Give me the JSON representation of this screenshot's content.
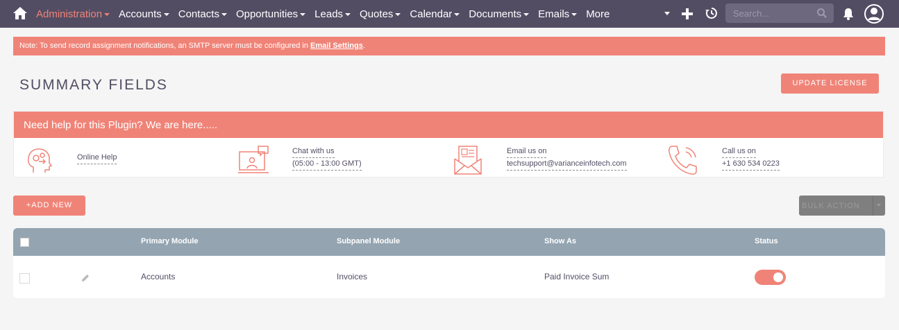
{
  "colors": {
    "accent": "#f08377",
    "navbar": "#534d64",
    "table_header": "#94a4b1"
  },
  "navbar": {
    "items": [
      {
        "label": "Administration",
        "active": true
      },
      {
        "label": "Accounts"
      },
      {
        "label": "Contacts"
      },
      {
        "label": "Opportunities"
      },
      {
        "label": "Leads"
      },
      {
        "label": "Quotes"
      },
      {
        "label": "Calendar"
      },
      {
        "label": "Documents"
      },
      {
        "label": "Emails"
      },
      {
        "label": "More"
      }
    ],
    "search_placeholder": "Search..."
  },
  "note": {
    "text": "Note: To send record assignment notifications, an SMTP server must be configured in ",
    "link": "Email Settings",
    "suffix": "."
  },
  "page": {
    "title": "SUMMARY FIELDS",
    "update_license": "UPDATE LICENSE",
    "add_new": "+ADD NEW",
    "bulk_action": "BULK ACTION"
  },
  "help": {
    "header": "Need help for this Plugin? We are here.....",
    "online_help": "Online Help",
    "chat_line1": "Chat with us",
    "chat_line2": "(05:00 - 13:00 GMT)",
    "email_line1": "Email us on",
    "email_line2": "techsupport@varianceinfotech.com",
    "call_line1": "Call us on",
    "call_line2": "+1 630 534 0223"
  },
  "table": {
    "headers": [
      "Primary Module",
      "Subpanel Module",
      "Show As",
      "Status"
    ],
    "rows": [
      {
        "primary": "Accounts",
        "subpanel": "Invoices",
        "show_as": "Paid Invoice Sum",
        "status": true
      }
    ]
  }
}
